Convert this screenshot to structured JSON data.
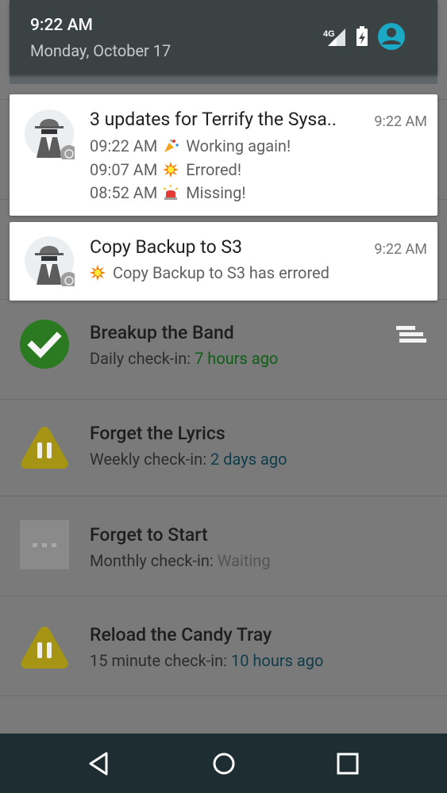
{
  "status": {
    "time": "9:22 AM",
    "date": "Monday, October 17",
    "network_label": "4G"
  },
  "notifications": [
    {
      "title": "3 updates for Terrify the Sysa..",
      "time": "9:22 AM",
      "lines": [
        {
          "time": "09:22 AM",
          "emoji": "party-popper-emoji",
          "text": "Working again!"
        },
        {
          "time": "09:07 AM",
          "emoji": "collision-emoji",
          "text": "Errored!"
        },
        {
          "time": "08:52 AM",
          "emoji": "siren-emoji",
          "text": "Missing!"
        }
      ]
    },
    {
      "title": "Copy Backup to S3",
      "time": "9:22 AM",
      "lines": [
        {
          "emoji": "collision-emoji",
          "text": "Copy Backup to S3 has errored"
        }
      ]
    }
  ],
  "checks": [
    {
      "title": "Breakup the Band",
      "label": "Daily check-in:",
      "value": "7 hours ago",
      "status": "ok"
    },
    {
      "title": "Forget the Lyrics",
      "label": "Weekly check-in:",
      "value": "2 days ago",
      "status": "late"
    },
    {
      "title": "Forget to Start",
      "label": "Monthly check-in:",
      "value": "Waiting",
      "status": "waiting"
    },
    {
      "title": "Reload the Candy Tray",
      "label": "15 minute check-in:",
      "value": "10 hours ago",
      "status": "late"
    }
  ],
  "colors": {
    "ok": "#2e7d32",
    "late": "#b5a015",
    "waiting": "#8c8c8c",
    "qs_background": "#3a4244",
    "accent": "#1ba9c6"
  }
}
